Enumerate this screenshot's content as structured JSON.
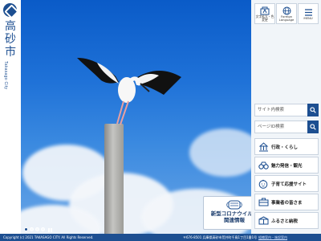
{
  "brand": {
    "city_name_chars": [
      "高",
      "砂",
      "市"
    ],
    "city_name_en": "Takasago City",
    "color": "#1d4f91"
  },
  "utility": [
    {
      "label_lines": [
        "文字拡大・色",
        "変更"
      ],
      "icon": "font-resize-icon"
    },
    {
      "label_lines": [
        "Foreign",
        "Language"
      ],
      "icon": "globe-icon"
    },
    {
      "label_lines": [
        "MENU"
      ],
      "icon": "menu-icon"
    }
  ],
  "search": [
    {
      "placeholder": "サイト内検索"
    },
    {
      "placeholder": "ページID検索"
    }
  ],
  "nav": [
    {
      "label": "行政・くらし",
      "icon": "city-hall-icon"
    },
    {
      "label": "魅力発信・観光",
      "icon": "binoculars-icon"
    },
    {
      "label": "子育て応援サイト",
      "icon": "child-face-icon"
    },
    {
      "label": "事業者の皆さま",
      "icon": "briefcase-icon"
    },
    {
      "label": "ふるさと納税",
      "icon": "furusato-icon"
    }
  ],
  "covid": {
    "line1": "新型コロナウイルス",
    "line2": "関連情報"
  },
  "slideshow": {
    "slide_count": 4,
    "active_index": 0
  },
  "footer": {
    "copyright": "Copyright (c) 2021 TAKASAGO CITY. All Rights Reserved.",
    "address": "〒676-8501 兵庫県高砂市荒井町千鳥1丁目1番1号",
    "link": "組織案内・施設案内"
  }
}
